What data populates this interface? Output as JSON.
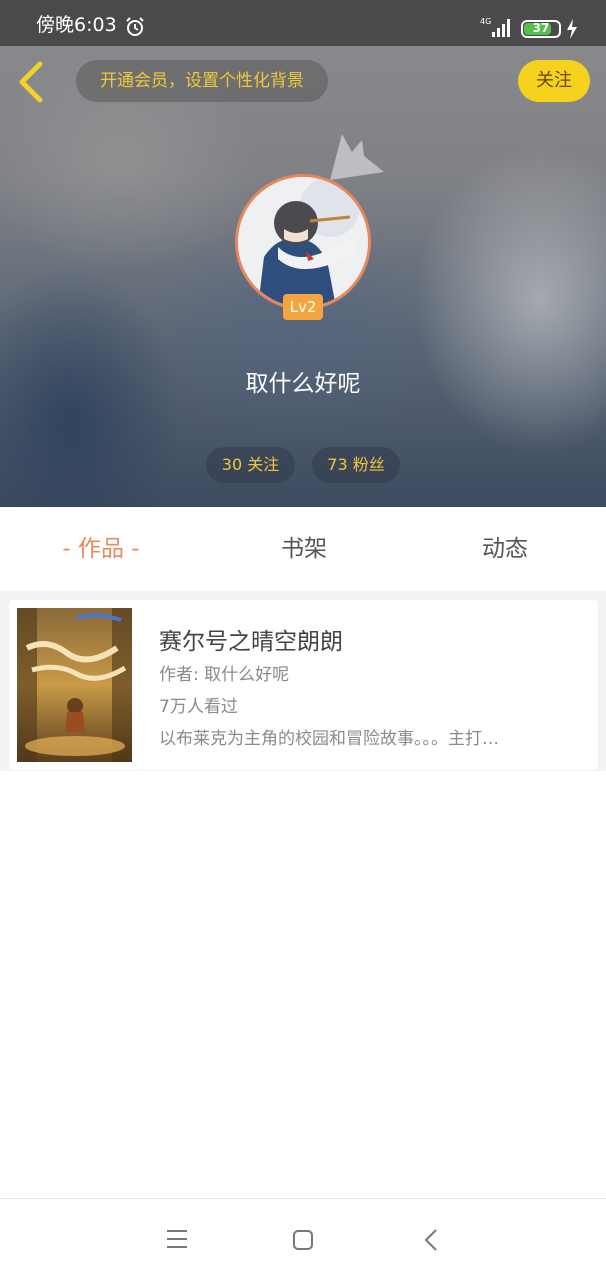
{
  "status_bar": {
    "time": "傍晚6:03",
    "network": "4G",
    "battery": "37"
  },
  "header": {
    "vip_prompt": "开通会员，设置个性化背景",
    "follow_label": "关注"
  },
  "profile": {
    "level": "Lv2",
    "username": "取什么好呢",
    "following": "30 关注",
    "fans": "73 粉丝"
  },
  "tabs": [
    {
      "label": "- 作品 -",
      "active": true
    },
    {
      "label": "书架",
      "active": false
    },
    {
      "label": "动态",
      "active": false
    }
  ],
  "works": [
    {
      "title": "赛尔号之晴空朗朗",
      "author": "作者: 取什么好呢",
      "views": "7万人看过",
      "description": "以布莱克为主角的校园和冒险故事。。。主打…"
    }
  ],
  "colors": {
    "accent": "#e9895c",
    "follow_button": "#f6d21c",
    "stat_text": "#f3c43f",
    "level_badge": "#f4a540"
  }
}
